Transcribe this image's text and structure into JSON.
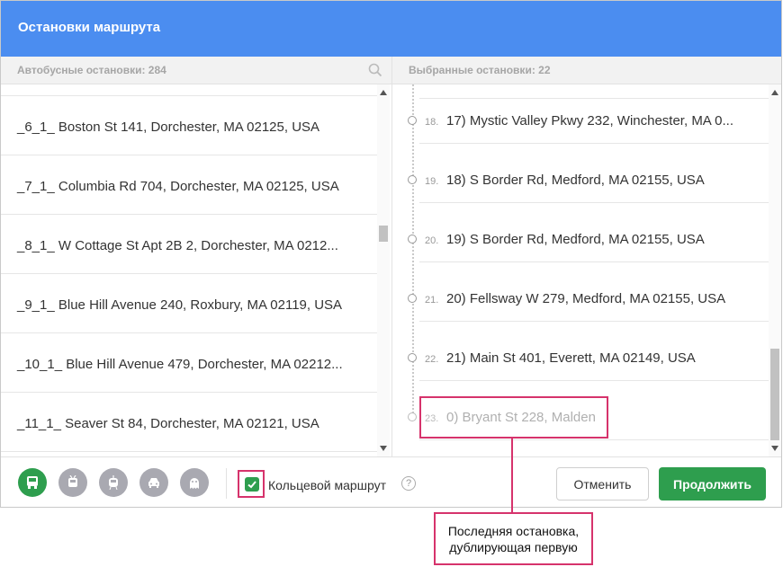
{
  "dialog": {
    "title": "Остановки маршрута"
  },
  "left_panel": {
    "header": "Автобусные остановки: 284",
    "items": [
      "_6_1_ Boston St 141, Dorchester, MA 02125, USA",
      "_7_1_ Columbia Rd 704, Dorchester, MA 02125, USA",
      "_8_1_ W Cottage St Apt 2B 2, Dorchester, MA 0212...",
      "_9_1_ Blue Hill Avenue 240, Roxbury, MA 02119, USA",
      "_10_1_ Blue Hill Avenue 479, Dorchester, MA 02212...",
      "_11_1_ Seaver St 84, Dorchester, MA 02121, USA"
    ]
  },
  "right_panel": {
    "header": "Выбранные остановки: 22",
    "items": [
      {
        "num": "18.",
        "address": "17) Mystic Valley Pkwy 232, Winchester, MA 0..."
      },
      {
        "num": "19.",
        "address": "18) S Border Rd, Medford, MA 02155, USA"
      },
      {
        "num": "20.",
        "address": "19) S Border Rd, Medford, MA 02155, USA"
      },
      {
        "num": "21.",
        "address": "20) Fellsway W 279, Medford, MA 02155, USA"
      },
      {
        "num": "22.",
        "address": "21) Main St 401, Everett, MA 02149, USA"
      },
      {
        "num": "23.",
        "address": "0) Bryant St 228, Malden"
      }
    ]
  },
  "footer": {
    "transport_icons": [
      "bus-icon",
      "trolleybus-icon",
      "tram-icon",
      "taxi-icon",
      "ghost-icon"
    ],
    "circular_route_label": "Кольцевой маршрут",
    "circular_route_checked": true,
    "help_glyph": "?",
    "cancel_label": "Отменить",
    "continue_label": "Продолжить"
  },
  "annotation": {
    "line1": "Последняя остановка,",
    "line2": "дублирующая первую"
  },
  "colors": {
    "header_bg": "#4b8df0",
    "accent_green": "#2e9e4e",
    "annotation": "#d6336c"
  }
}
